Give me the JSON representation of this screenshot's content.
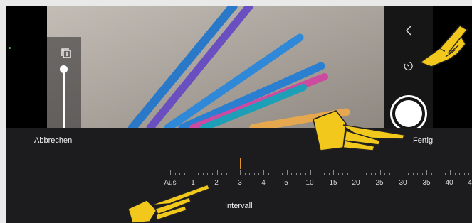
{
  "toolbar": {
    "cancel_label": "Abbrechen",
    "done_label": "Fertig"
  },
  "interval_picker": {
    "title": "Intervall",
    "scale_labels": [
      "Aus",
      "1",
      "2",
      "3",
      "4",
      "5",
      "10",
      "15",
      "20",
      "25",
      "30",
      "35",
      "40",
      "4"
    ],
    "selected_value": "3"
  },
  "camera": {
    "left_tool_icon": "burst-stack-icon",
    "right_icons": [
      "chevron-left-icon",
      "timer-icon",
      "shutter-button"
    ]
  },
  "colors": {
    "panel_bg": "#1c1c1e",
    "indicator": "#e0942a",
    "hand_pointer": "#f2c81c"
  }
}
